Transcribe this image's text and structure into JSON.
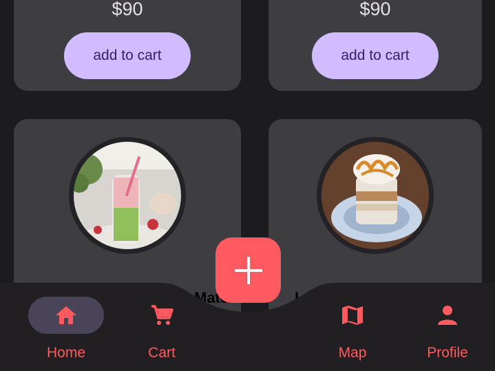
{
  "products": [
    {
      "price": "$90",
      "button": "add to cart"
    },
    {
      "price": "$90",
      "button": "add to cart"
    },
    {
      "name": "Matcha"
    },
    {
      "name": "Latte"
    }
  ],
  "fab": {
    "icon": "plus-icon"
  },
  "nav": {
    "items": [
      {
        "label": "Home",
        "icon": "home-icon",
        "active": true
      },
      {
        "label": "Cart",
        "icon": "cart-icon",
        "active": false
      },
      {
        "label": "Map",
        "icon": "map-icon",
        "active": false
      },
      {
        "label": "Profile",
        "icon": "person-icon",
        "active": false
      }
    ]
  },
  "colors": {
    "background": "#1c1b1f",
    "card": "#3e3d41",
    "button": "#d0bcff",
    "button_text": "#381e72",
    "accent": "#ff5a5f",
    "nav_bar": "#211f22",
    "active_pill": "#4a4458"
  }
}
